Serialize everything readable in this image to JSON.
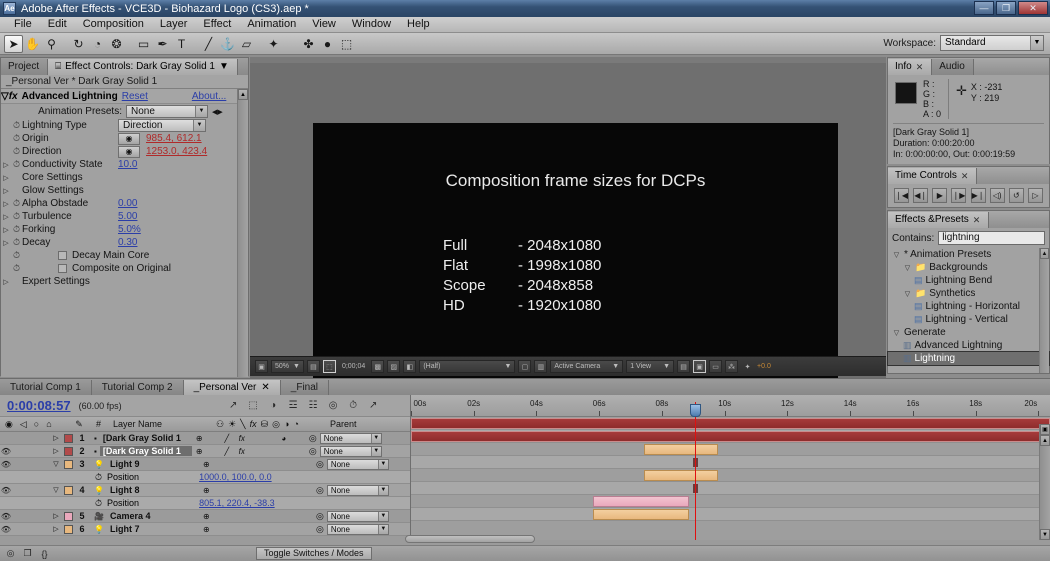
{
  "window": {
    "title": "Adobe After Effects - VCE3D - Biohazard Logo (CS3).aep *",
    "logo": "Ae",
    "minimize": "—",
    "restore": "❐",
    "close": "✕"
  },
  "menu": [
    "File",
    "Edit",
    "Composition",
    "Layer",
    "Effect",
    "Animation",
    "View",
    "Window",
    "Help"
  ],
  "toolbar": {
    "tools": [
      {
        "name": "selection-tool",
        "glyph": "➤",
        "active": true
      },
      {
        "name": "hand-tool",
        "glyph": "✋",
        "active": false
      },
      {
        "name": "zoom-tool",
        "glyph": "⚲",
        "active": false
      },
      {
        "name": "rotation-tool",
        "glyph": "↻",
        "active": false
      },
      {
        "name": "orbit-camera-tool",
        "glyph": "◔",
        "active": false
      },
      {
        "name": "pan-behind-tool",
        "glyph": "❂",
        "active": false
      },
      {
        "name": "shape-tool",
        "glyph": "▭",
        "active": false
      },
      {
        "name": "pen-tool",
        "glyph": "✒",
        "active": false
      },
      {
        "name": "text-tool",
        "glyph": "T",
        "active": false
      },
      {
        "name": "brush-tool",
        "glyph": "╱",
        "active": false
      },
      {
        "name": "clone-stamp-tool",
        "glyph": "⚓",
        "active": false
      },
      {
        "name": "eraser-tool",
        "glyph": "▱",
        "active": false
      },
      {
        "name": "puppet-pin-tool",
        "glyph": "✦",
        "active": false
      }
    ],
    "right_icons": [
      {
        "name": "local-axis-icon",
        "glyph": "✤"
      },
      {
        "name": "world-axis-icon",
        "glyph": "●"
      },
      {
        "name": "view-axis-icon",
        "glyph": "⬚"
      }
    ],
    "workspace_label": "Workspace:",
    "workspace_value": "Standard"
  },
  "effect_controls": {
    "tabs": [
      {
        "label": "Project",
        "active": false,
        "closable": false
      },
      {
        "label": "Effect Controls: Dark Gray Solid 1",
        "active": true,
        "closable": false
      }
    ],
    "subtitle": "_Personal Ver * Dark Gray Solid 1",
    "effect_name": "Advanced Lightning",
    "reset_label": "Reset",
    "about_label": "About...",
    "animation_presets_label": "Animation Presets:",
    "animation_presets_value": "None",
    "properties": [
      {
        "name": "Lightning Type",
        "type": "dropdown",
        "value": "Direction",
        "twirl": false,
        "stopwatch": true
      },
      {
        "name": "Origin",
        "type": "point",
        "value": "985.4, 612.1",
        "twirl": false,
        "stopwatch": true
      },
      {
        "name": "Direction",
        "type": "point",
        "value": "1253.0, 423.4",
        "twirl": false,
        "stopwatch": true
      },
      {
        "name": "Conductivity State",
        "type": "value",
        "value": "10.0",
        "twirl": true,
        "stopwatch": true
      },
      {
        "name": "Core Settings",
        "type": "group",
        "value": "",
        "twirl": true,
        "stopwatch": false
      },
      {
        "name": "Glow Settings",
        "type": "group",
        "value": "",
        "twirl": true,
        "stopwatch": false
      },
      {
        "name": "Alpha Obstade",
        "type": "value",
        "value": "0.00",
        "twirl": true,
        "stopwatch": true
      },
      {
        "name": "Turbulence",
        "type": "value",
        "value": "5.00",
        "twirl": true,
        "stopwatch": true
      },
      {
        "name": "Forking",
        "type": "value",
        "value": "5.0%",
        "twirl": true,
        "stopwatch": true
      },
      {
        "name": "Decay",
        "type": "value",
        "value": "0.30",
        "twirl": true,
        "stopwatch": true
      },
      {
        "name": "Decay Main Core",
        "type": "checkbox",
        "value": "",
        "twirl": false,
        "stopwatch": true
      },
      {
        "name": "Composite on Original",
        "type": "checkbox",
        "value": "",
        "twirl": false,
        "stopwatch": true
      },
      {
        "name": "Expert Settings",
        "type": "group",
        "value": "",
        "twirl": true,
        "stopwatch": false
      }
    ]
  },
  "composition": {
    "title": "Composition frame sizes for DCPs",
    "rows": [
      {
        "label": "Full",
        "value": "- 2048x1080"
      },
      {
        "label": "Flat",
        "value": "- 1998x1080"
      },
      {
        "label": "Scope",
        "value": "- 2048x858"
      },
      {
        "label": "HD",
        "value": "- 1920x1080"
      }
    ],
    "toolbar": {
      "magnification": "50%",
      "timecode": "0;00;04",
      "resolution": "(Half)",
      "camera": "Active Camera",
      "views": "1 View",
      "exposure": "+0.0"
    }
  },
  "info_panel": {
    "tabs": [
      {
        "label": "Info",
        "active": true,
        "closable": true
      },
      {
        "label": "Audio",
        "active": false,
        "closable": false
      }
    ],
    "channels": [
      {
        "label": "R :",
        "value": ""
      },
      {
        "label": "G :",
        "value": ""
      },
      {
        "label": "B :",
        "value": ""
      },
      {
        "label": "A :",
        "value": "0"
      }
    ],
    "coords": [
      {
        "label": "X :",
        "value": "-231"
      },
      {
        "label": "Y :",
        "value": "219"
      }
    ],
    "layer_name": "[Dark Gray Solid 1]",
    "duration": "Duration: 0:00:20:00",
    "inout": "In: 0:00:00:00, Out: 0:00:19:59"
  },
  "time_controls": {
    "tab": "Time Controls",
    "buttons": [
      {
        "name": "first-frame-button",
        "glyph": "❘◀"
      },
      {
        "name": "previous-frame-button",
        "glyph": "◀❘"
      },
      {
        "name": "play-button",
        "glyph": "▶"
      },
      {
        "name": "next-frame-button",
        "glyph": "❘▶"
      },
      {
        "name": "last-frame-button",
        "glyph": "▶❘"
      },
      {
        "name": "audio-toggle-button",
        "glyph": "◁)"
      },
      {
        "name": "loop-button",
        "glyph": "↺"
      },
      {
        "name": "ram-preview-button",
        "glyph": "▷"
      }
    ]
  },
  "effects_presets": {
    "tab": "Effects &Presets",
    "contains_label": "Contains:",
    "contains_value": "lightning",
    "tree": [
      {
        "label": "* Animation Presets",
        "depth": 0,
        "icon": "twirl-open",
        "selected": false
      },
      {
        "label": "Backgrounds",
        "depth": 1,
        "icon": "folder",
        "selected": false
      },
      {
        "label": "Lightning Bend",
        "depth": 2,
        "icon": "preset",
        "selected": false
      },
      {
        "label": "Synthetics",
        "depth": 1,
        "icon": "folder",
        "selected": false
      },
      {
        "label": "Lightning - Horizontal",
        "depth": 2,
        "icon": "preset",
        "selected": false
      },
      {
        "label": "Lightning - Vertical",
        "depth": 2,
        "icon": "preset",
        "selected": false
      },
      {
        "label": "Generate",
        "depth": 0,
        "icon": "twirl-open",
        "selected": false
      },
      {
        "label": "Advanced Lightning",
        "depth": 1,
        "icon": "effect",
        "selected": false
      },
      {
        "label": "Lightning",
        "depth": 1,
        "icon": "effect",
        "selected": true
      }
    ]
  },
  "timeline": {
    "tabs": [
      {
        "label": "Tutorial Comp 1",
        "active": false,
        "closable": false
      },
      {
        "label": "Tutorial Comp 2",
        "active": false,
        "closable": false
      },
      {
        "label": "_Personal Ver",
        "active": true,
        "closable": true
      },
      {
        "label": "_Final",
        "active": false,
        "closable": false
      }
    ],
    "current_time": "0:00:08:57",
    "fps": "(60.00 fps)",
    "header_icons": [
      {
        "name": "live-update-icon",
        "glyph": "↗"
      },
      {
        "name": "draft-3d-icon",
        "glyph": "⬚"
      },
      {
        "name": "hide-shy-layers-icon",
        "glyph": "◑"
      },
      {
        "name": "enable-frame-blending-icon",
        "glyph": "☲"
      },
      {
        "name": "enable-motion-blur-icon",
        "glyph": "☷"
      },
      {
        "name": "brainstorm-icon",
        "glyph": "◎"
      },
      {
        "name": "auto-keyframe-icon",
        "glyph": "⏱"
      },
      {
        "name": "graph-editor-icon",
        "glyph": "↗"
      }
    ],
    "columns": {
      "av_icons": [
        {
          "name": "video-toggle-icon",
          "glyph": "◉"
        },
        {
          "name": "audio-toggle-icon",
          "glyph": "◁"
        },
        {
          "name": "solo-toggle-icon",
          "glyph": "○"
        },
        {
          "name": "lock-toggle-icon",
          "glyph": "⌂"
        }
      ],
      "label_col": "",
      "num_col": "#",
      "name_col": "Layer Name",
      "switch_icons": [
        {
          "name": "shy-switch-icon",
          "glyph": "⚇"
        },
        {
          "name": "collapse-switch-icon",
          "glyph": "☀"
        },
        {
          "name": "quality-switch-icon",
          "glyph": "╲"
        },
        {
          "name": "effects-switch-icon",
          "glyph": "fx"
        },
        {
          "name": "frame-blend-switch-icon",
          "glyph": "⛁"
        },
        {
          "name": "motion-blur-switch-icon",
          "glyph": "◎"
        },
        {
          "name": "adjustment-switch-icon",
          "glyph": "◑"
        },
        {
          "name": "3d-switch-icon",
          "glyph": "◔"
        }
      ],
      "parent_col": "Parent"
    },
    "layers": [
      {
        "num": "1",
        "name": "[Dark Gray Solid 1",
        "color": "#b24a4a",
        "type": "solid",
        "visible": false,
        "selected": false,
        "twirl": "closed",
        "parent": "None",
        "switches": [
          "shy",
          "quality",
          "fx",
          "adjustment"
        ],
        "bar": {
          "type": "red",
          "start": 0,
          "width": 100
        },
        "prop": null
      },
      {
        "num": "2",
        "name": "[Dark Gray Solid 1",
        "color": "#b24a4a",
        "type": "solid",
        "visible": true,
        "selected": true,
        "twirl": "closed",
        "parent": "None",
        "switches": [
          "shy",
          "quality",
          "fx"
        ],
        "bar": {
          "type": "red",
          "start": 0,
          "width": 100
        },
        "prop": null
      },
      {
        "num": "3",
        "name": "Light 9",
        "color": "#e8b87e",
        "type": "light",
        "visible": true,
        "selected": false,
        "twirl": "open",
        "parent": "None",
        "switches": [
          "shy"
        ],
        "bar": {
          "type": "orange",
          "start": 36.5,
          "width": 11.5
        },
        "prop": {
          "name": "Position",
          "value": "1000.0, 100.0, 0.0",
          "keyframe": 44.5
        }
      },
      {
        "num": "4",
        "name": "Light 8",
        "color": "#e8b87e",
        "type": "light",
        "visible": true,
        "selected": false,
        "twirl": "open",
        "parent": "None",
        "switches": [
          "shy"
        ],
        "bar": {
          "type": "orange",
          "start": 36.5,
          "width": 11.5
        },
        "prop": {
          "name": "Position",
          "value": "805.1, 220.4, -38.3",
          "keyframe": 44.5
        }
      },
      {
        "num": "5",
        "name": "Camera 4",
        "color": "#eaa8bc",
        "type": "camera",
        "visible": true,
        "selected": false,
        "twirl": "closed",
        "parent": "None",
        "switches": [
          "shy"
        ],
        "bar": {
          "type": "pink",
          "start": 28.5,
          "width": 15
        },
        "prop": null
      },
      {
        "num": "6",
        "name": "Light 7",
        "color": "#e8b87e",
        "type": "light",
        "visible": true,
        "selected": false,
        "twirl": "closed",
        "parent": "None",
        "switches": [
          "shy"
        ],
        "bar": {
          "type": "orange",
          "start": 28.5,
          "width": 15
        },
        "prop": null
      }
    ],
    "ruler_ticks": [
      "00s",
      "02s",
      "04s",
      "06s",
      "08s",
      "10s",
      "12s",
      "14s",
      "16s",
      "18s",
      "20s"
    ],
    "playhead_percent": 44.5,
    "toggle_switches_label": "Toggle Switches / Modes",
    "bottom_icons": [
      {
        "name": "comp-flowchart-icon",
        "glyph": "◎"
      },
      {
        "name": "motion-blur-bottom-icon",
        "glyph": "❐"
      },
      {
        "name": "graph-editor-bottom-icon",
        "glyph": "{}"
      }
    ]
  }
}
